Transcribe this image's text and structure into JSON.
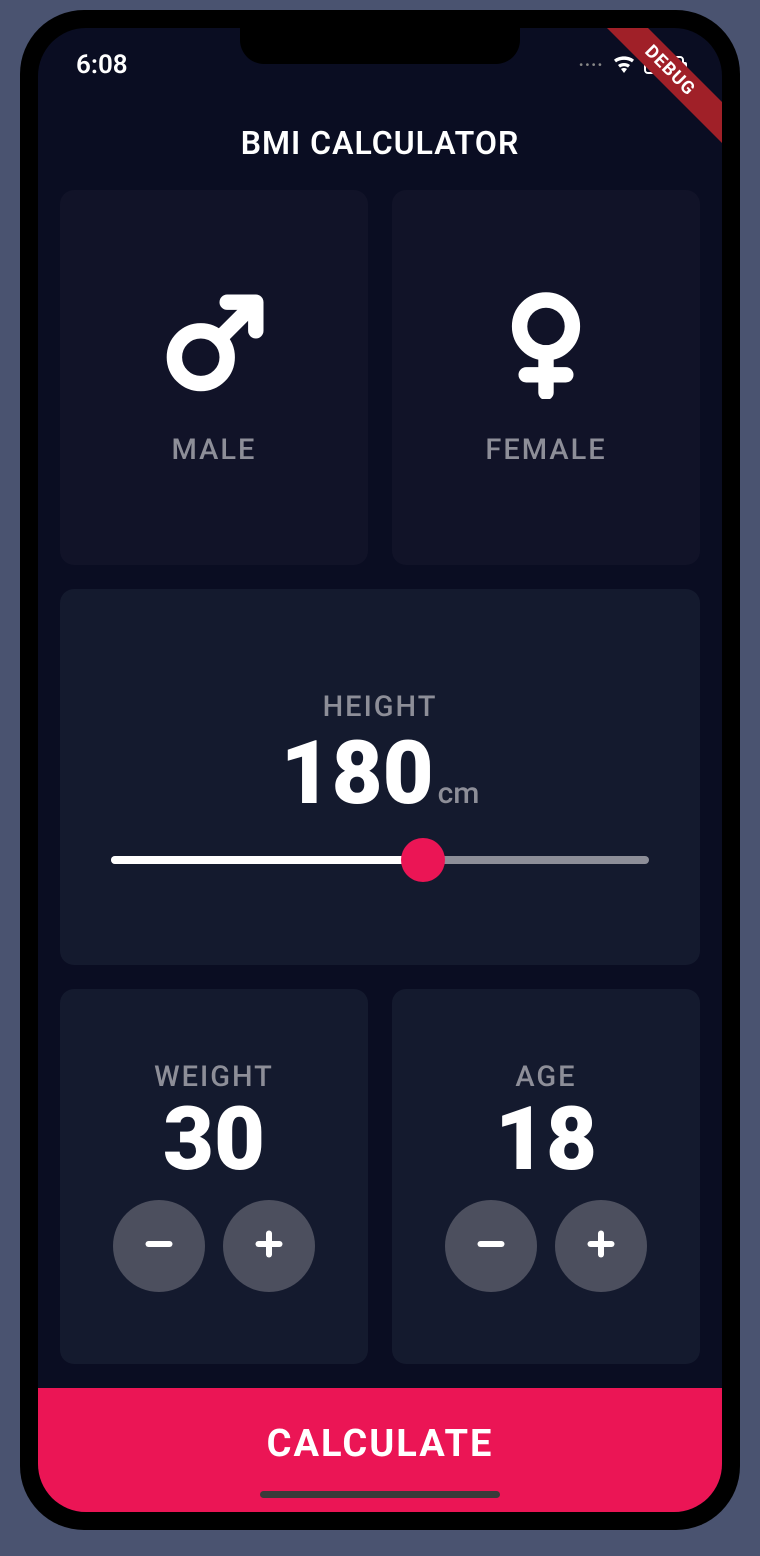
{
  "status": {
    "time": "6:08",
    "debug_label": "DEBUG"
  },
  "header": {
    "title": "BMI CALCULATOR"
  },
  "gender": {
    "male_label": "MALE",
    "female_label": "FEMALE"
  },
  "height": {
    "label": "HEIGHT",
    "value": "180",
    "unit": "cm",
    "slider_percent": 58
  },
  "weight": {
    "label": "WEIGHT",
    "value": "30"
  },
  "age": {
    "label": "AGE",
    "value": "18"
  },
  "actions": {
    "calculate_label": "CALCULATE"
  },
  "colors": {
    "accent": "#eb1555",
    "card": "#141a2e",
    "card_inactive": "#111328",
    "text_muted": "#8d8e98",
    "bg": "#0a0d22"
  }
}
